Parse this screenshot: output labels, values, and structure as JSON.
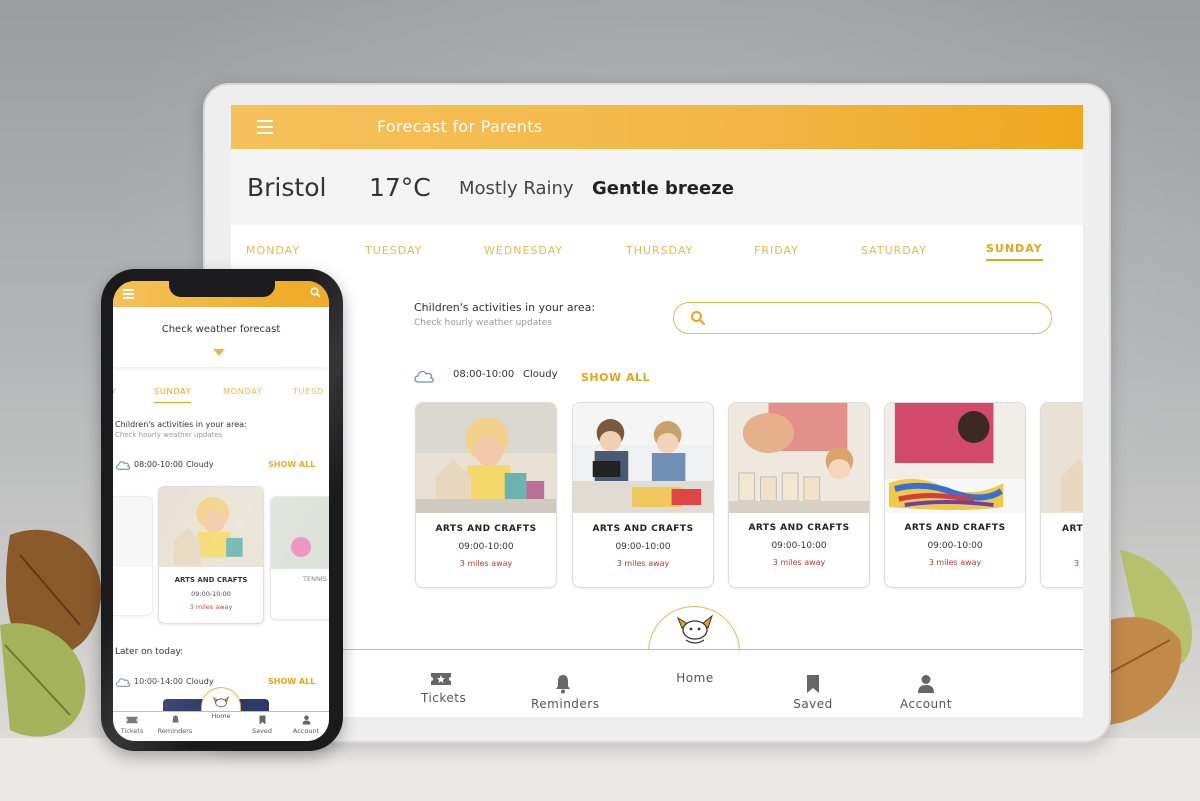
{
  "tablet": {
    "app_title": "Forecast for Parents",
    "city": "Bristol",
    "temperature": "17°C",
    "condition": "Mostly Rainy",
    "wind": "Gentle breeze",
    "days": [
      "MONDAY",
      "TUESDAY",
      "WEDNESDAY",
      "THURSDAY",
      "FRIDAY",
      "SATURDAY",
      "SUNDAY"
    ],
    "selected_day": "SUNDAY",
    "section_title": "Children's activities in your area:",
    "section_subtitle": "Check hourly weather updates",
    "slot_time": "08:00-10:00",
    "slot_weather": "Cloudy",
    "show_all": "SHOW ALL",
    "cards": [
      {
        "title": "ARTS AND CRAFTS",
        "time": "09:00-10:00",
        "distance": "3 miles away"
      },
      {
        "title": "ARTS AND CRAFTS",
        "time": "09:00-10:00",
        "distance": "3 miles away"
      },
      {
        "title": "ARTS AND CRAFTS",
        "time": "09:00-10:00",
        "distance": "3 miles away"
      },
      {
        "title": "ARTS AND CRAFTS",
        "time": "09:00-10:00",
        "distance": "3 miles away"
      },
      {
        "title": "ART",
        "time": "",
        "distance": "3"
      }
    ],
    "nav": {
      "tickets": "Tickets",
      "reminders": "Reminders",
      "home": "Home",
      "saved": "Saved",
      "account": "Account"
    }
  },
  "phone": {
    "check_forecast": "Check weather forecast",
    "days": [
      "Y",
      "SUNDAY",
      "MONDAY",
      "TUESD"
    ],
    "selected_day": "SUNDAY",
    "section_title": "Children's activities in your area:",
    "section_subtitle": "Check hourly weather updates",
    "slot1_time": "08:00-10:00",
    "slot1_weather": "Cloudy",
    "show_all": "SHOW ALL",
    "main_card": {
      "title": "ARTS AND CRAFTS",
      "time": "09:00-10:00",
      "distance": "3 miles away"
    },
    "side_card": {
      "title": "TENNIS"
    },
    "later_title": "Later on today:",
    "slot2_time": "10:00-14:00",
    "slot2_weather": "Cloudy",
    "nav": {
      "tickets": "Tickets",
      "reminders": "Reminders",
      "home": "Home",
      "saved": "Saved",
      "account": "Account"
    }
  },
  "colors": {
    "accent": "#efb64c",
    "accent_dark": "#e8a317",
    "distance": "#c0392b"
  }
}
